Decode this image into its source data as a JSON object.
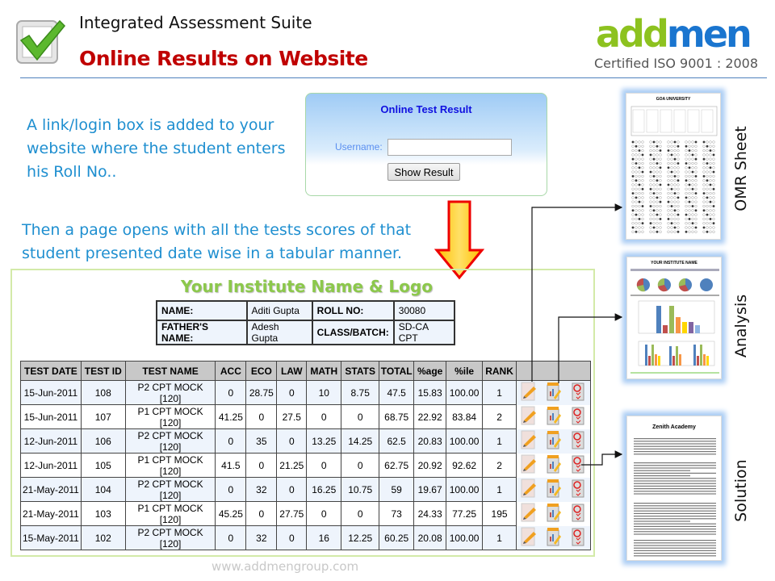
{
  "header": {
    "suite": "Integrated Assessment Suite",
    "title": "Online Results on Website",
    "logo": {
      "part1": "add",
      "part2": "men"
    },
    "certification": "Certified ISO 9001 : 2008"
  },
  "intro_text": "A link/login box is added to your website where the student enters his Roll No..",
  "login_box": {
    "title": "Online Test Result",
    "username_label": "Username:",
    "username_value": "",
    "button": "Show Result"
  },
  "second_text": "Then a page opens with all the tests scores of that student presented date wise in a tabular manner.",
  "result_page": {
    "institute": "Your Institute Name & Logo",
    "student": {
      "name_label": "NAME:",
      "name": "Aditi Gupta",
      "roll_label": "ROLL NO:",
      "roll": "30080",
      "father_label": "FATHER'S NAME:",
      "father": "Adesh Gupta",
      "class_label": "CLASS/BATCH:",
      "class": "SD-CA CPT"
    },
    "columns": [
      "TEST DATE",
      "TEST ID",
      "TEST NAME",
      "ACC",
      "ECO",
      "LAW",
      "MATH",
      "STATS",
      "TOTAL",
      "%age",
      "%ile",
      "RANK"
    ],
    "rows": [
      [
        "15-Jun-2011",
        "108",
        "P2 CPT MOCK [120]",
        "0",
        "28.75",
        "0",
        "10",
        "8.75",
        "47.5",
        "15.83",
        "100.00",
        "1"
      ],
      [
        "15-Jun-2011",
        "107",
        "P1 CPT MOCK [120]",
        "41.25",
        "0",
        "27.5",
        "0",
        "0",
        "68.75",
        "22.92",
        "83.84",
        "2"
      ],
      [
        "12-Jun-2011",
        "106",
        "P2 CPT MOCK [120]",
        "0",
        "35",
        "0",
        "13.25",
        "14.25",
        "62.5",
        "20.83",
        "100.00",
        "1"
      ],
      [
        "12-Jun-2011",
        "105",
        "P1 CPT MOCK [120]",
        "41.5",
        "0",
        "21.25",
        "0",
        "0",
        "62.75",
        "20.92",
        "92.62",
        "2"
      ],
      [
        "21-May-2011",
        "104",
        "P2 CPT MOCK [120]",
        "0",
        "32",
        "0",
        "16.25",
        "10.75",
        "59",
        "19.67",
        "100.00",
        "1"
      ],
      [
        "21-May-2011",
        "103",
        "P1 CPT MOCK [120]",
        "45.25",
        "0",
        "27.75",
        "0",
        "0",
        "73",
        "24.33",
        "77.25",
        "195"
      ],
      [
        "15-May-2011",
        "102",
        "P2 CPT MOCK [120]",
        "0",
        "32",
        "0",
        "16",
        "12.25",
        "60.25",
        "20.08",
        "100.00",
        "1"
      ]
    ],
    "row_icons": [
      "omr-sheet-icon",
      "analysis-icon",
      "solution-icon"
    ]
  },
  "previews": [
    {
      "label": "OMR Sheet",
      "heading": "GOA UNIVERSITY"
    },
    {
      "label": "Analysis",
      "heading": "YOUR INSTITUTE NAME"
    },
    {
      "label": "Solution",
      "heading": "Zenith Academy"
    }
  ],
  "footer": "www.addmengroup.com",
  "colors": {
    "title_red": "#c00000",
    "text_blue": "#1f8fd0",
    "institute_green": "#8cc84b",
    "logo_green": "#8dc21f",
    "logo_blue": "#1a75cf"
  }
}
